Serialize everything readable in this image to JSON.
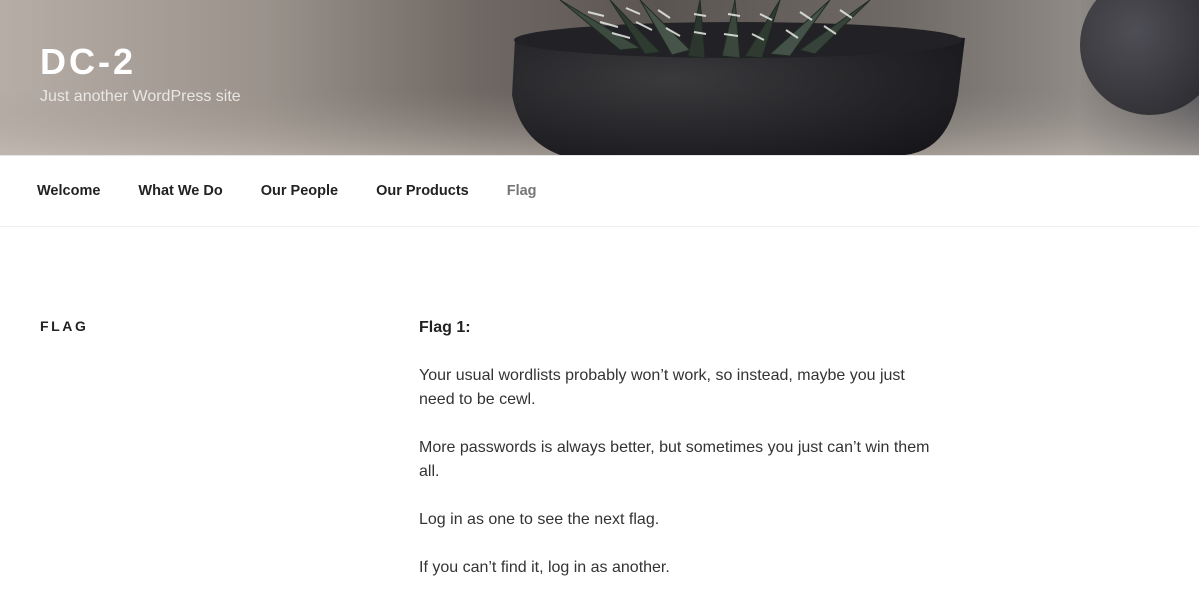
{
  "site": {
    "title": "DC-2",
    "description": "Just another WordPress site"
  },
  "nav": {
    "items": [
      {
        "label": "Welcome"
      },
      {
        "label": "What We Do"
      },
      {
        "label": "Our People"
      },
      {
        "label": "Our Products"
      },
      {
        "label": "Flag"
      }
    ],
    "current": "Flag"
  },
  "page": {
    "title": "FLAG",
    "heading": "Flag 1:",
    "paragraphs": [
      "Your usual wordlists probably won’t work, so instead, maybe you just need to be cewl.",
      "More passwords is always better, but sometimes you just can’t win them all.",
      "Log in as one to see the next flag.",
      "If you can’t find it, log in as another."
    ]
  },
  "colors": {
    "title_text": "#ffffff",
    "nav_text": "#222222",
    "nav_current": "#767676",
    "body_text": "#333333"
  }
}
